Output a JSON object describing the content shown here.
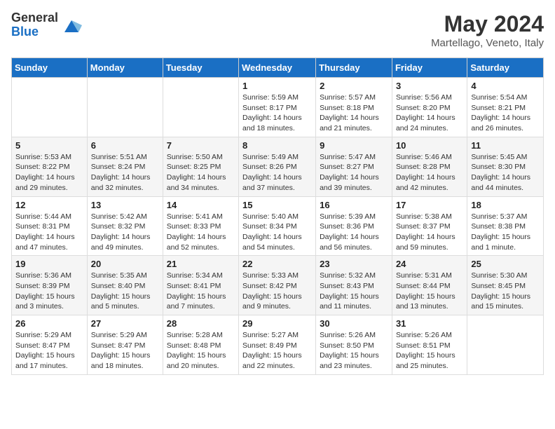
{
  "header": {
    "logo_general": "General",
    "logo_blue": "Blue",
    "month_title": "May 2024",
    "location": "Martellago, Veneto, Italy"
  },
  "days_of_week": [
    "Sunday",
    "Monday",
    "Tuesday",
    "Wednesday",
    "Thursday",
    "Friday",
    "Saturday"
  ],
  "weeks": [
    [
      {
        "day": "",
        "info": ""
      },
      {
        "day": "",
        "info": ""
      },
      {
        "day": "",
        "info": ""
      },
      {
        "day": "1",
        "info": "Sunrise: 5:59 AM\nSunset: 8:17 PM\nDaylight: 14 hours and 18 minutes."
      },
      {
        "day": "2",
        "info": "Sunrise: 5:57 AM\nSunset: 8:18 PM\nDaylight: 14 hours and 21 minutes."
      },
      {
        "day": "3",
        "info": "Sunrise: 5:56 AM\nSunset: 8:20 PM\nDaylight: 14 hours and 24 minutes."
      },
      {
        "day": "4",
        "info": "Sunrise: 5:54 AM\nSunset: 8:21 PM\nDaylight: 14 hours and 26 minutes."
      }
    ],
    [
      {
        "day": "5",
        "info": "Sunrise: 5:53 AM\nSunset: 8:22 PM\nDaylight: 14 hours and 29 minutes."
      },
      {
        "day": "6",
        "info": "Sunrise: 5:51 AM\nSunset: 8:24 PM\nDaylight: 14 hours and 32 minutes."
      },
      {
        "day": "7",
        "info": "Sunrise: 5:50 AM\nSunset: 8:25 PM\nDaylight: 14 hours and 34 minutes."
      },
      {
        "day": "8",
        "info": "Sunrise: 5:49 AM\nSunset: 8:26 PM\nDaylight: 14 hours and 37 minutes."
      },
      {
        "day": "9",
        "info": "Sunrise: 5:47 AM\nSunset: 8:27 PM\nDaylight: 14 hours and 39 minutes."
      },
      {
        "day": "10",
        "info": "Sunrise: 5:46 AM\nSunset: 8:28 PM\nDaylight: 14 hours and 42 minutes."
      },
      {
        "day": "11",
        "info": "Sunrise: 5:45 AM\nSunset: 8:30 PM\nDaylight: 14 hours and 44 minutes."
      }
    ],
    [
      {
        "day": "12",
        "info": "Sunrise: 5:44 AM\nSunset: 8:31 PM\nDaylight: 14 hours and 47 minutes."
      },
      {
        "day": "13",
        "info": "Sunrise: 5:42 AM\nSunset: 8:32 PM\nDaylight: 14 hours and 49 minutes."
      },
      {
        "day": "14",
        "info": "Sunrise: 5:41 AM\nSunset: 8:33 PM\nDaylight: 14 hours and 52 minutes."
      },
      {
        "day": "15",
        "info": "Sunrise: 5:40 AM\nSunset: 8:34 PM\nDaylight: 14 hours and 54 minutes."
      },
      {
        "day": "16",
        "info": "Sunrise: 5:39 AM\nSunset: 8:36 PM\nDaylight: 14 hours and 56 minutes."
      },
      {
        "day": "17",
        "info": "Sunrise: 5:38 AM\nSunset: 8:37 PM\nDaylight: 14 hours and 59 minutes."
      },
      {
        "day": "18",
        "info": "Sunrise: 5:37 AM\nSunset: 8:38 PM\nDaylight: 15 hours and 1 minute."
      }
    ],
    [
      {
        "day": "19",
        "info": "Sunrise: 5:36 AM\nSunset: 8:39 PM\nDaylight: 15 hours and 3 minutes."
      },
      {
        "day": "20",
        "info": "Sunrise: 5:35 AM\nSunset: 8:40 PM\nDaylight: 15 hours and 5 minutes."
      },
      {
        "day": "21",
        "info": "Sunrise: 5:34 AM\nSunset: 8:41 PM\nDaylight: 15 hours and 7 minutes."
      },
      {
        "day": "22",
        "info": "Sunrise: 5:33 AM\nSunset: 8:42 PM\nDaylight: 15 hours and 9 minutes."
      },
      {
        "day": "23",
        "info": "Sunrise: 5:32 AM\nSunset: 8:43 PM\nDaylight: 15 hours and 11 minutes."
      },
      {
        "day": "24",
        "info": "Sunrise: 5:31 AM\nSunset: 8:44 PM\nDaylight: 15 hours and 13 minutes."
      },
      {
        "day": "25",
        "info": "Sunrise: 5:30 AM\nSunset: 8:45 PM\nDaylight: 15 hours and 15 minutes."
      }
    ],
    [
      {
        "day": "26",
        "info": "Sunrise: 5:29 AM\nSunset: 8:47 PM\nDaylight: 15 hours and 17 minutes."
      },
      {
        "day": "27",
        "info": "Sunrise: 5:29 AM\nSunset: 8:47 PM\nDaylight: 15 hours and 18 minutes."
      },
      {
        "day": "28",
        "info": "Sunrise: 5:28 AM\nSunset: 8:48 PM\nDaylight: 15 hours and 20 minutes."
      },
      {
        "day": "29",
        "info": "Sunrise: 5:27 AM\nSunset: 8:49 PM\nDaylight: 15 hours and 22 minutes."
      },
      {
        "day": "30",
        "info": "Sunrise: 5:26 AM\nSunset: 8:50 PM\nDaylight: 15 hours and 23 minutes."
      },
      {
        "day": "31",
        "info": "Sunrise: 5:26 AM\nSunset: 8:51 PM\nDaylight: 15 hours and 25 minutes."
      },
      {
        "day": "",
        "info": ""
      }
    ]
  ]
}
